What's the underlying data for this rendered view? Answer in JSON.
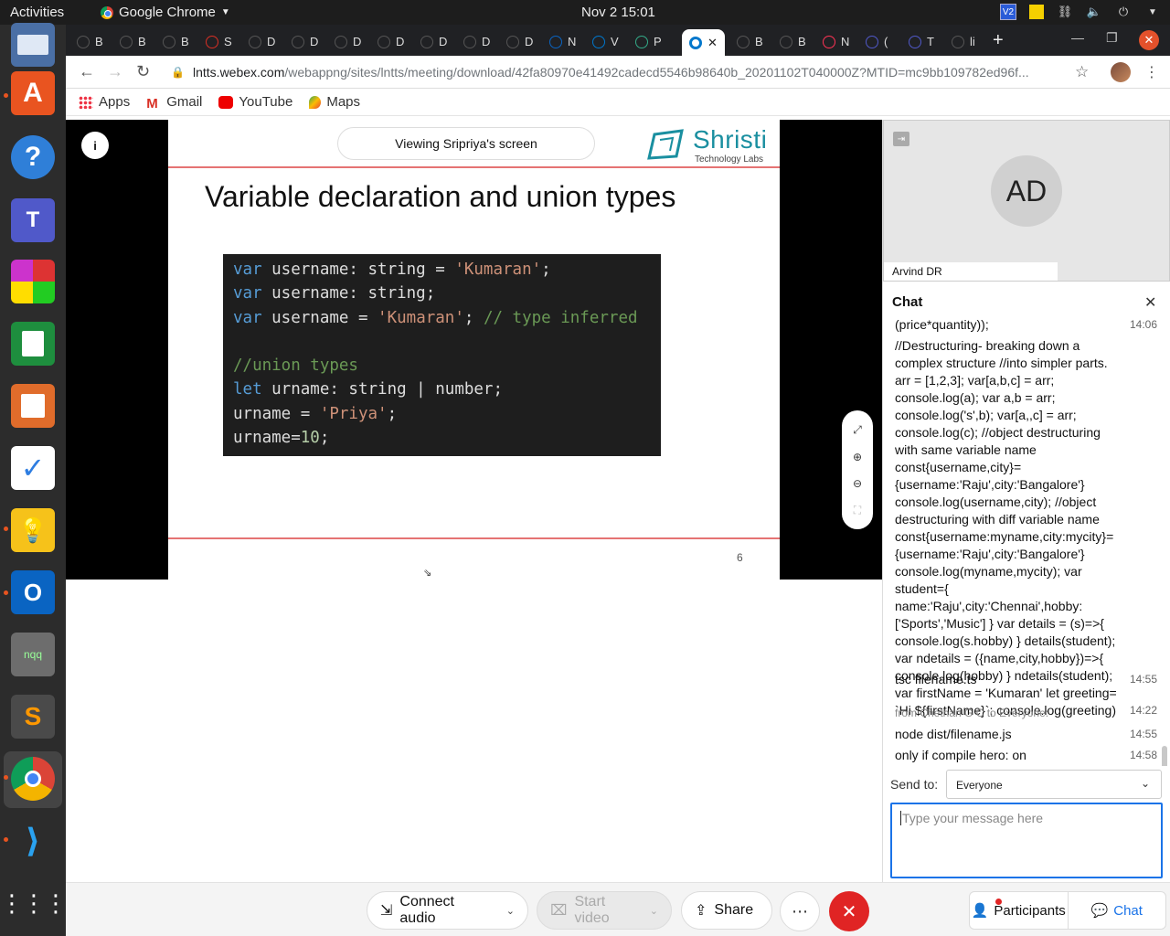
{
  "topbar": {
    "activities": "Activities",
    "app_menu": "Google Chrome",
    "clock": "Nov 2  15:01"
  },
  "tabs": [
    {
      "label": "B"
    },
    {
      "label": "B"
    },
    {
      "label": "B"
    },
    {
      "label": "S"
    },
    {
      "label": "D"
    },
    {
      "label": "D"
    },
    {
      "label": "D"
    },
    {
      "label": "D"
    },
    {
      "label": "D"
    },
    {
      "label": "D"
    },
    {
      "label": "D"
    },
    {
      "label": "N"
    },
    {
      "label": "V"
    },
    {
      "label": "P"
    },
    {
      "label": ""
    },
    {
      "label": "B"
    },
    {
      "label": "B"
    },
    {
      "label": "N"
    },
    {
      "label": "("
    },
    {
      "label": "T"
    },
    {
      "label": "li"
    }
  ],
  "address_bar": {
    "host": "lntts.webex.com",
    "path": "/webappng/sites/lntts/meeting/download/42fa80970e41492cadecd5546b98640b_20201102T040000Z?MTID=mc9bb109782ed96f..."
  },
  "bookmarks": [
    {
      "label": "Apps",
      "icon": "apps-grid-icon"
    },
    {
      "label": "Gmail",
      "icon": "gmail-icon"
    },
    {
      "label": "YouTube",
      "icon": "youtube-icon"
    },
    {
      "label": "Maps",
      "icon": "maps-icon"
    }
  ],
  "stage": {
    "viewing_label": "Viewing Sripriya's screen",
    "brand_name": "Shristi",
    "brand_tagline": "Technology Labs",
    "slide_title": "Variable declaration and union types",
    "slide_number": "6",
    "code_lines": [
      "var username: string = 'Kumaran';",
      "var username: string;",
      "var username = 'Kumaran'; // type inferred",
      "",
      "//union types",
      "let urname: string | number;",
      "urname = 'Priya';",
      "urname=10;"
    ]
  },
  "participant": {
    "initials": "AD",
    "name": "Arvind DR"
  },
  "chat": {
    "title": "Chat",
    "messages": [
      {
        "text": "(price*quantity));",
        "time": "14:06"
      },
      {
        "text": "//Destructuring- breaking down a complex structure //into simpler parts. arr = [1,2,3]; var[a,b,c] = arr; console.log(a); var a,b = arr; console.log('s',b); var[a,,c] = arr; console.log(c); //object destructuring with same variable name const{username,city}={username:'Raju',city:'Bangalore'} console.log(username,city); //object destructuring with diff variable name const{username:myname,city:mycity}={username:'Raju',city:'Bangalore'} console.log(myname,mycity); var student={ name:'Raju',city:'Chennai',hobby:['Sports','Music'] } var details = (s)=>{ console.log(s.hobby) } details(student); var ndetails = ({name,city,hobby})=>{ console.log(hobby) } ndetails(student); var firstName = 'Kumaran' let greeting= `Hi ${firstName}`; console.log(greeting)",
        "time": "14:22"
      },
      {
        "text": "tsc filename.ts",
        "time": "14:55"
      },
      {
        "text": "node dist/filename.js",
        "time": "14:55"
      },
      {
        "text": "only if compile hero: on",
        "time": "14:58"
      }
    ],
    "from_line": "from Chethan G C to Everyone:",
    "send_to_label": "Send to:",
    "send_to_value": "Everyone",
    "input_placeholder": "Type your message here"
  },
  "controls": {
    "connect_audio": "Connect audio",
    "start_video": "Start video",
    "share": "Share",
    "participants": "Participants",
    "chat": "Chat"
  }
}
